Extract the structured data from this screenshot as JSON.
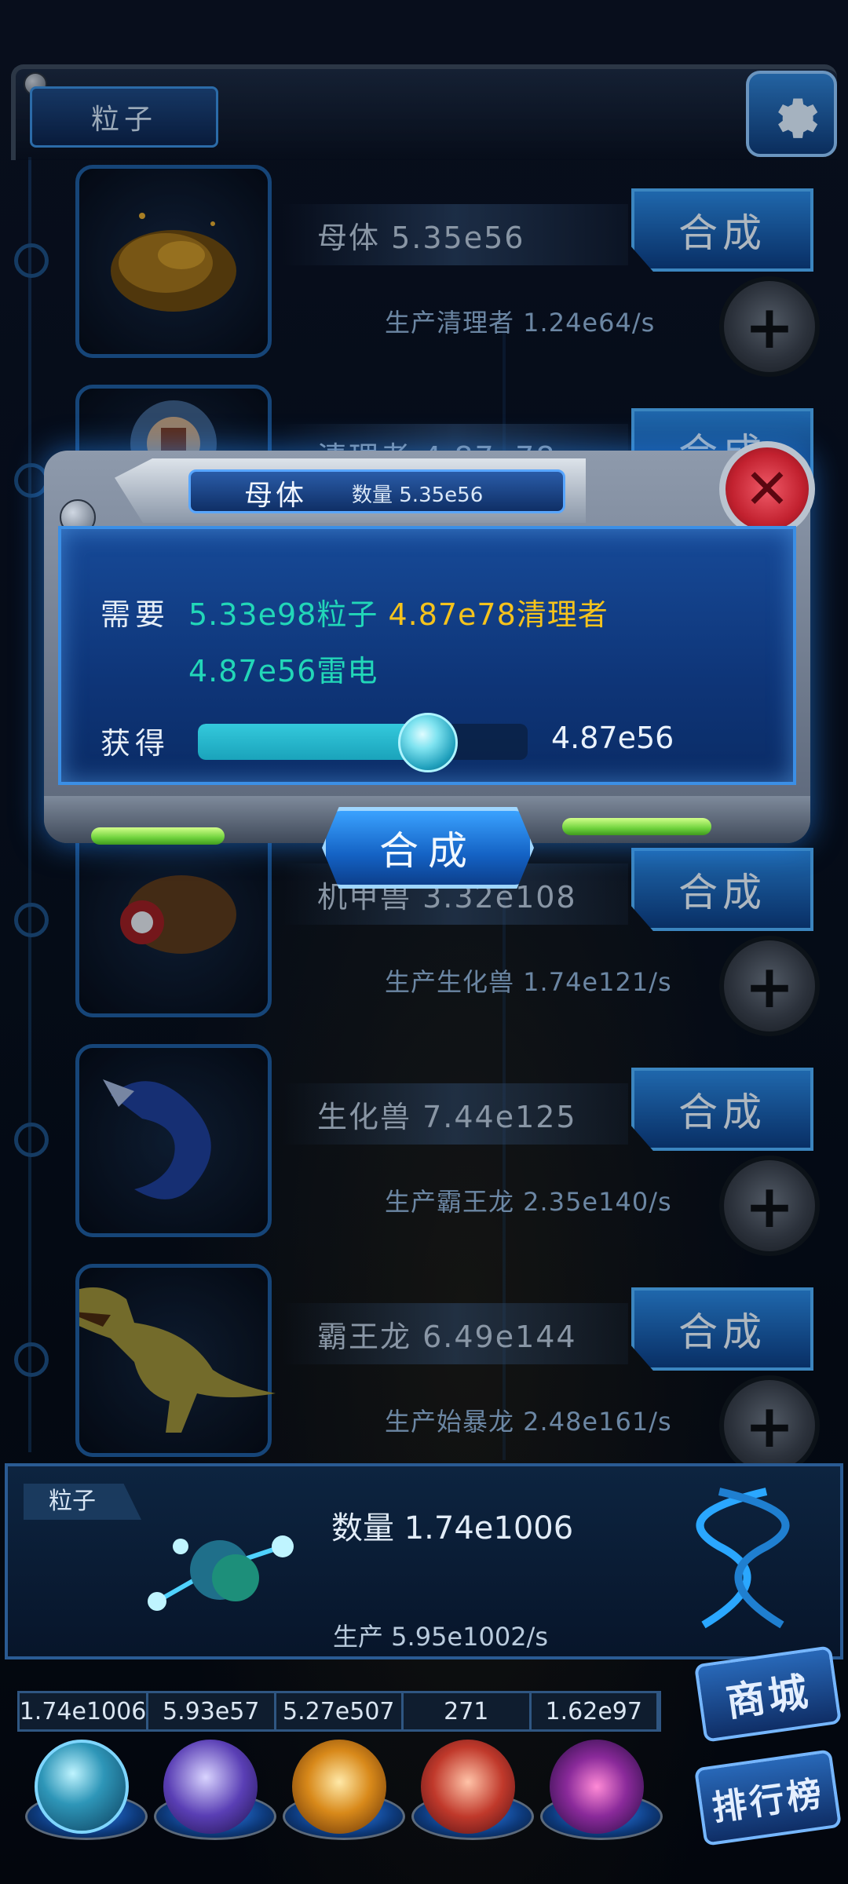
{
  "top": {
    "tab_label": "粒子"
  },
  "rows": [
    {
      "name": "母体 5.35e56",
      "merge": "合成",
      "production": "生产清理者 1.24e64/s"
    },
    {
      "name": "清理者 4.87e78",
      "merge": "合成",
      "production": ""
    },
    {
      "name": "机甲兽 3.32e108",
      "merge": "合成",
      "production": "生产生化兽 1.74e121/s"
    },
    {
      "name": "生化兽 7.44e125",
      "merge": "合成",
      "production": "生产霸王龙 2.35e140/s"
    },
    {
      "name": "霸王龙 6.49e144",
      "merge": "合成",
      "production": "生产始暴龙 2.48e161/s"
    }
  ],
  "dialog": {
    "title": "母体",
    "count": "数量 5.35e56",
    "need_label": "需要",
    "need_1": "5.33e98粒子",
    "need_2": "4.87e78清理者",
    "need_3": "4.87e56雷电",
    "get_label": "获得",
    "slider_fraction": 0.65,
    "get_value": "4.87e56",
    "merge_label": "合成"
  },
  "bottom": {
    "tag": "粒子",
    "count": "数量 1.74e1006",
    "production": "生产 5.95e1002/s",
    "resources": [
      "1.74e1006",
      "5.93e57",
      "5.27e507",
      "271",
      "1.62e97"
    ],
    "shop_label": "商城",
    "rank_label": "排行榜"
  },
  "colors": {
    "accent_cyan": "#22d7b8",
    "accent_yellow": "#f5c31c",
    "panel_blue": "#0e3578",
    "close_red": "#c2212f"
  },
  "icons": [
    "settings-gear-icon",
    "plus-icon",
    "close-x-icon",
    "molecule-icon",
    "dna-icon"
  ]
}
